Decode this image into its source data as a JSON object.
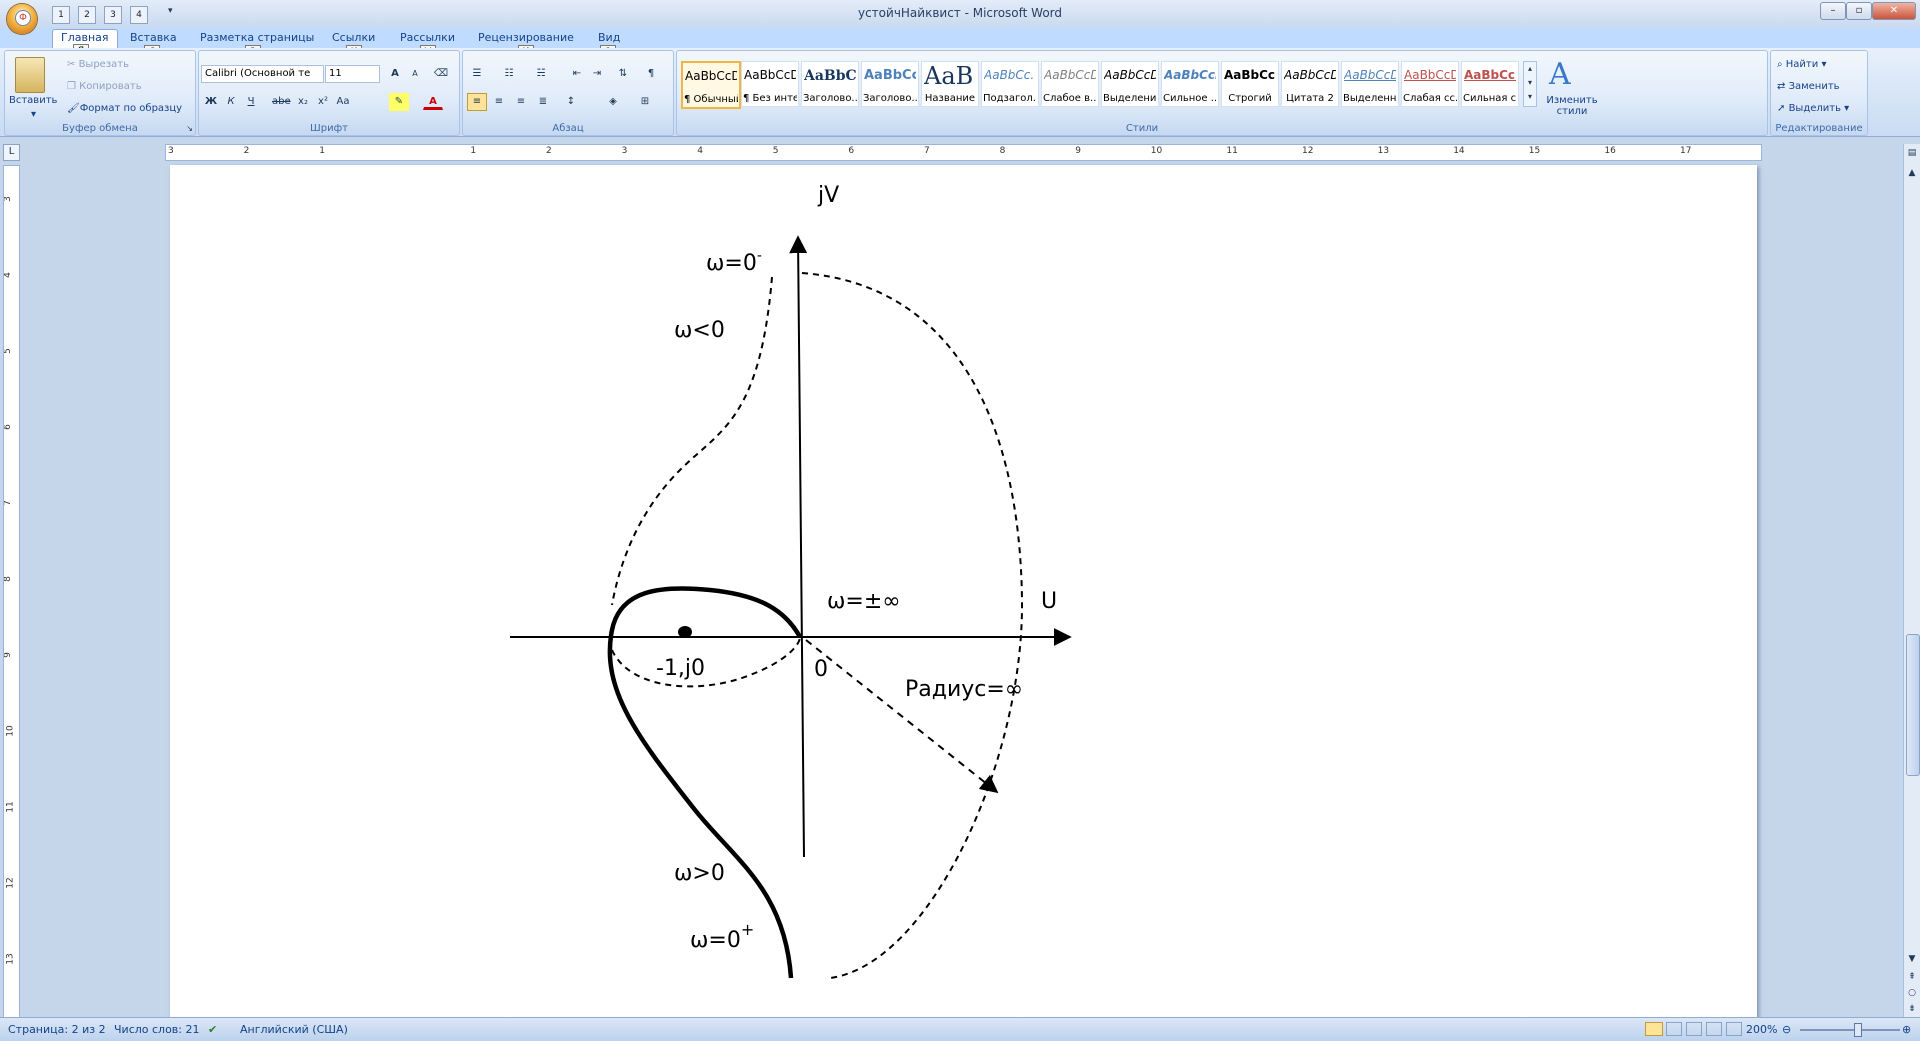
{
  "window": {
    "title": "устойчНайквист - Microsoft Word",
    "quick_access_keytips": [
      "1",
      "2",
      "3",
      "4"
    ],
    "office_button_keytip": "Ф"
  },
  "tabs": [
    {
      "label": "Главная",
      "keytip": "Я"
    },
    {
      "label": "Вставка",
      "keytip": "С"
    },
    {
      "label": "Разметка страницы",
      "keytip": "З"
    },
    {
      "label": "Ссылки",
      "keytip": "К"
    },
    {
      "label": "Рассылки",
      "keytip": "Ы"
    },
    {
      "label": "Рецензирование",
      "keytip": "И"
    },
    {
      "label": "Вид",
      "keytip": "О"
    }
  ],
  "ribbon": {
    "clipboard": {
      "label": "Буфер обмена",
      "paste": "Вставить",
      "cut": "Вырезать",
      "copy": "Копировать",
      "format_painter": "Формат по образцу"
    },
    "font": {
      "label": "Шрифт",
      "font_name": "Calibri (Основной те",
      "font_size": "11",
      "grow": "A",
      "shrink": "A",
      "bold": "Ж",
      "italic": "К",
      "underline": "Ч",
      "strike": "abe",
      "subscript": "x₂",
      "superscript": "x²",
      "case": "Aa"
    },
    "paragraph": {
      "label": "Абзац"
    },
    "styles": {
      "label": "Стили",
      "items": [
        {
          "preview": "AaBbCcDc",
          "name": "¶ Обычный"
        },
        {
          "preview": "AaBbCcDc",
          "name": "¶ Без инте..."
        },
        {
          "preview": "AaBbCc",
          "name": "Заголово..."
        },
        {
          "preview": "AaBbCc",
          "name": "Заголово..."
        },
        {
          "preview": "AaB",
          "name": "Название"
        },
        {
          "preview": "AaBbCc.",
          "name": "Подзагол..."
        },
        {
          "preview": "AaBbCcDı",
          "name": "Слабое в..."
        },
        {
          "preview": "AaBbCcDı",
          "name": "Выделение"
        },
        {
          "preview": "AaBbCcDı",
          "name": "Сильное ..."
        },
        {
          "preview": "AaBbCcDc",
          "name": "Строгий"
        },
        {
          "preview": "AaBbCcDı",
          "name": "Цитата 2"
        },
        {
          "preview": "AaBbCcDı",
          "name": "Выделенн..."
        },
        {
          "preview": "AaBbCcDı",
          "name": "Слабая сс..."
        },
        {
          "preview": "AaBbCcDı",
          "name": "Сильная с..."
        }
      ],
      "change_styles": "Изменить стили"
    },
    "editing": {
      "label": "Редактирование",
      "find": "Найти",
      "replace": "Заменить",
      "select": "Выделить"
    }
  },
  "ruler": {
    "h_marks": [
      "3",
      "2",
      "1",
      "",
      "1",
      "2",
      "3",
      "4",
      "5",
      "6",
      "7",
      "8",
      "9",
      "10",
      "11",
      "12",
      "13",
      "14",
      "15",
      "16",
      "17"
    ],
    "v_marks": [
      "3",
      "4",
      "5",
      "6",
      "7",
      "8",
      "9",
      "10",
      "11",
      "12",
      "13"
    ]
  },
  "figure": {
    "axis_y_label": "jV",
    "axis_x_label": "U",
    "omega_zero_minus": "ω=0",
    "omega_zero_minus_sup": "-",
    "omega_negative": "ω<0",
    "omega_inf": "ω=±∞",
    "point_label": "-1,j0",
    "origin_label": "0",
    "radius_label": "Радиус=∞",
    "omega_positive": "ω>0",
    "omega_zero_plus": "ω=0",
    "omega_zero_plus_sup": "+"
  },
  "status": {
    "page": "Страница: 2 из 2",
    "words": "Число слов: 21",
    "language": "Английский (США)",
    "zoom": "200%"
  }
}
